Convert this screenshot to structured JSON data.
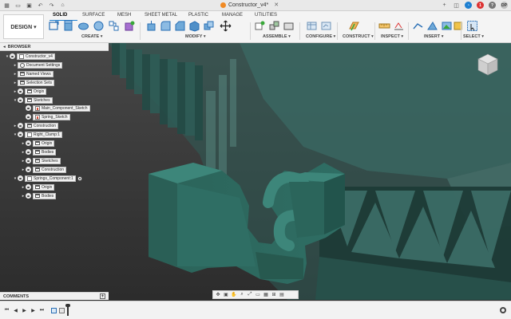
{
  "window": {
    "title": "Constructor_v4*"
  },
  "workspace": {
    "label": "DESIGN ▾"
  },
  "ribbon": {
    "tabs": [
      {
        "label": "SOLID",
        "active": true
      },
      {
        "label": "SURFACE"
      },
      {
        "label": "MESH"
      },
      {
        "label": "SHEET METAL"
      },
      {
        "label": "PLASTIC"
      },
      {
        "label": "MANAGE"
      },
      {
        "label": "UTILITIES"
      }
    ],
    "groups": [
      "CREATE ▾",
      "MODIFY ▾",
      "ASSEMBLE ▾",
      "CONFIGURE ▾",
      "CONSTRUCT ▾",
      "INSPECT ▾",
      "INSERT ▾",
      "SELECT ▾"
    ]
  },
  "header_right": {
    "notification_count": "1",
    "user_initials": "DP"
  },
  "browser": {
    "title": "BROWSER",
    "items": [
      {
        "label": "Constructor_v4",
        "level": 0,
        "icon": "component-icon",
        "expanded": true
      },
      {
        "label": "Document Settings",
        "level": 1,
        "icon": "gear-icon"
      },
      {
        "label": "Named Views",
        "level": 1,
        "icon": "folder-icon"
      },
      {
        "label": "Selection Sets",
        "level": 1,
        "icon": "folder-icon"
      },
      {
        "label": "Origin",
        "level": 1,
        "icon": "folder-icon"
      },
      {
        "label": "Sketches",
        "level": 1,
        "icon": "folder-icon",
        "expanded": true
      },
      {
        "label": "Main_Component_Sketch",
        "level": 2,
        "icon": "sketch-icon"
      },
      {
        "label": "Spring_Sketch",
        "level": 2,
        "icon": "sketch-icon"
      },
      {
        "label": "Construction",
        "level": 1,
        "icon": "folder-icon"
      },
      {
        "label": "Right_Clamp:1",
        "level": 1,
        "icon": "component-icon",
        "expanded": true
      },
      {
        "label": "Origin",
        "level": 2,
        "icon": "folder-icon"
      },
      {
        "label": "Bodies",
        "level": 2,
        "icon": "folder-icon"
      },
      {
        "label": "Sketches",
        "level": 2,
        "icon": "folder-icon"
      },
      {
        "label": "Construction",
        "level": 2,
        "icon": "folder-icon"
      },
      {
        "label": "Springs_Component:1",
        "level": 1,
        "icon": "component-icon",
        "active": true
      },
      {
        "label": "Origin",
        "level": 2,
        "icon": "folder-icon"
      },
      {
        "label": "Bodies",
        "level": 2,
        "icon": "folder-icon"
      }
    ]
  },
  "comments": {
    "title": "COMMENTS"
  },
  "colors": {
    "body": "#2f6e64",
    "body_light": "#3d867a",
    "background": "#3a3a3a",
    "accent": "#1d7fd1"
  }
}
